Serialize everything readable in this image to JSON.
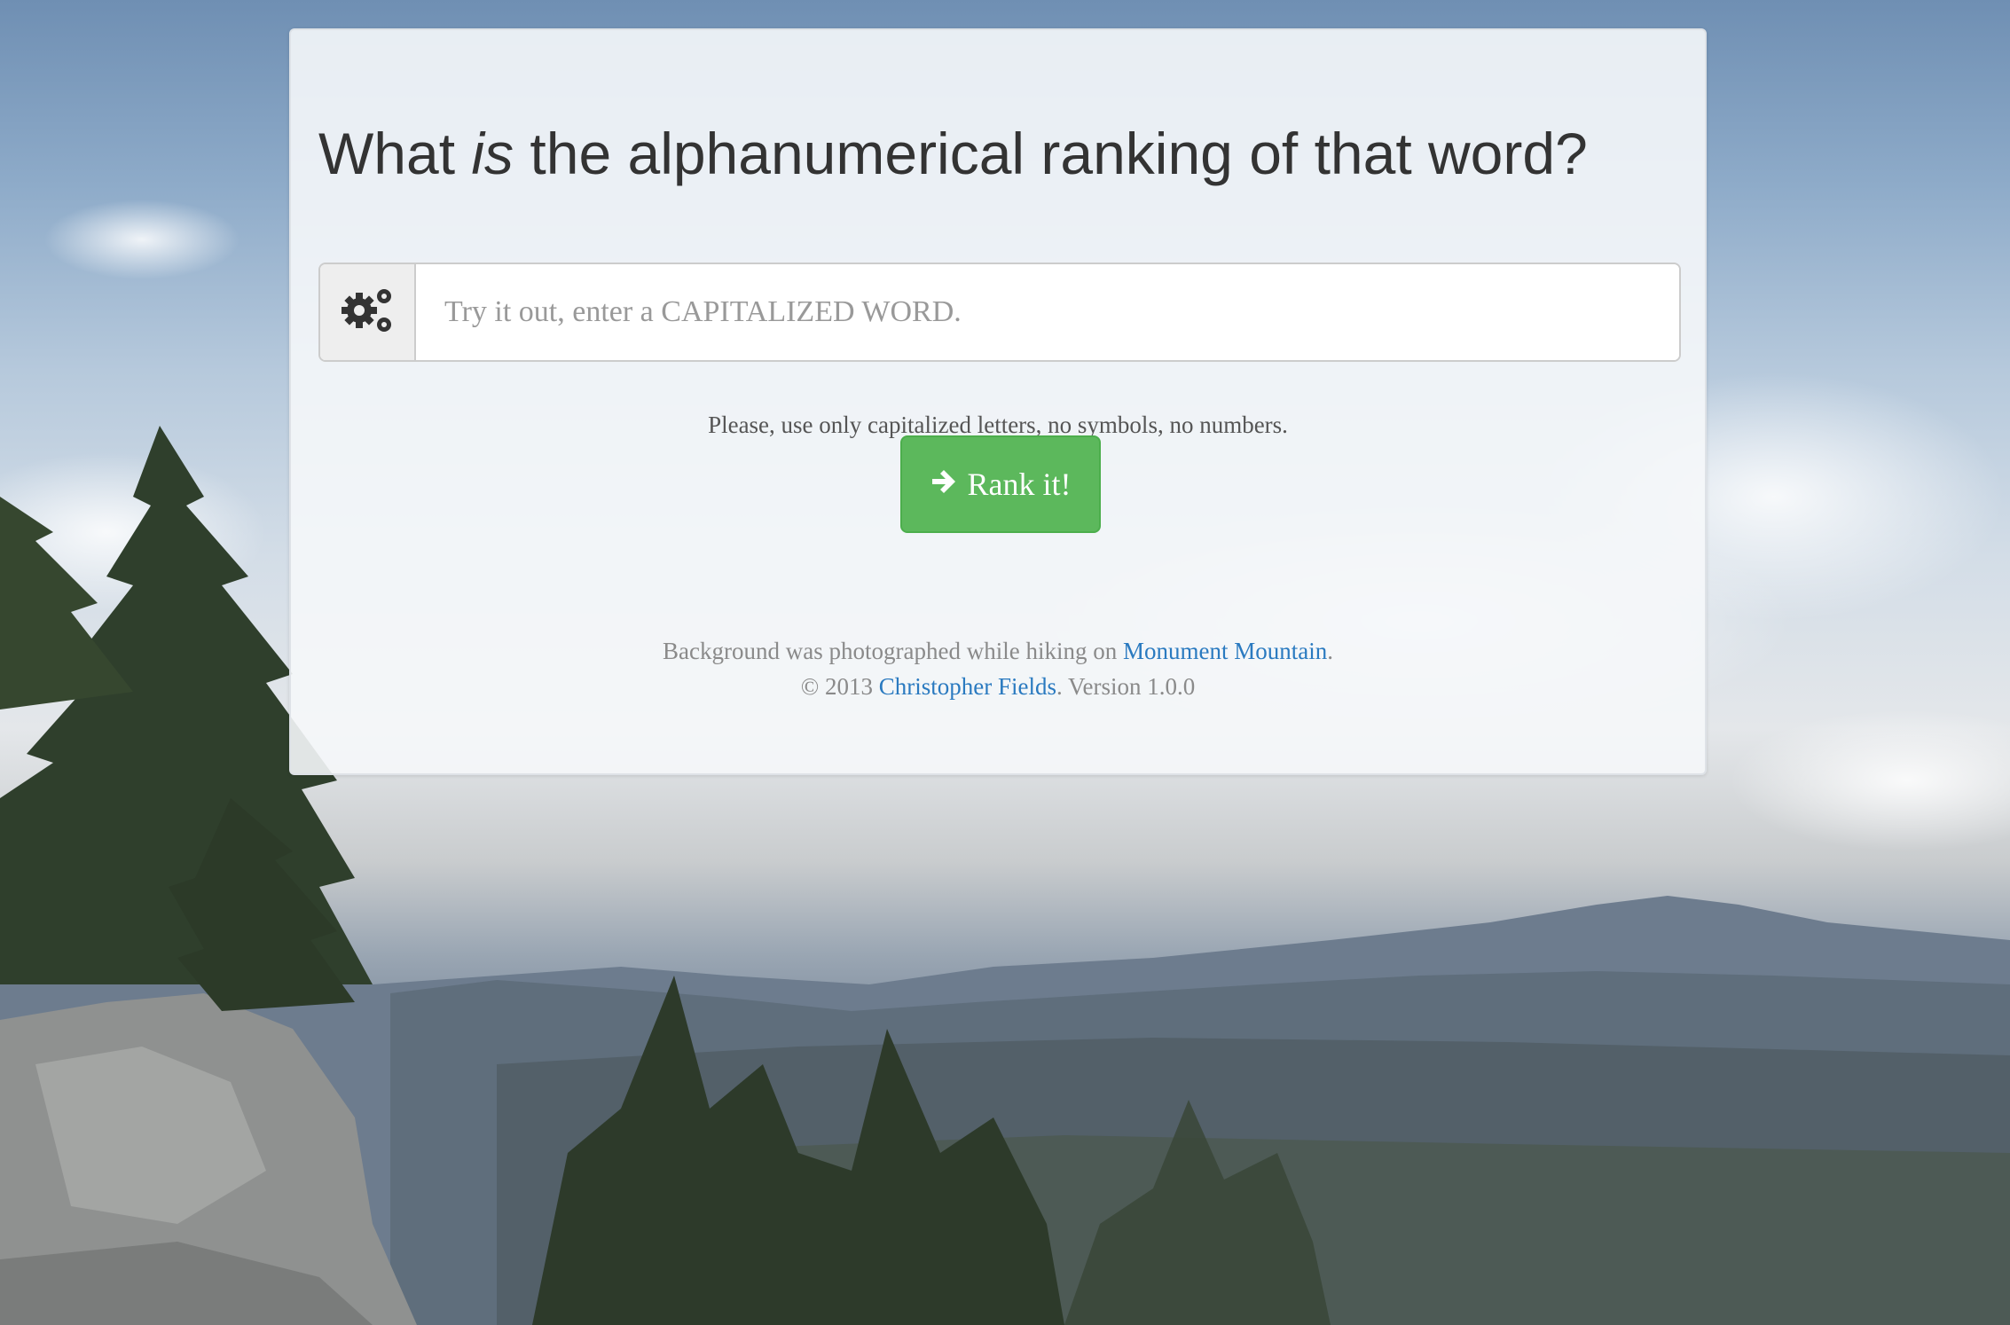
{
  "background": {
    "description_icon": "mountain-landscape-photo"
  },
  "panel": {
    "title_before": "What ",
    "title_em": "is",
    "title_after": " the alphanumerical ranking of that word?"
  },
  "form": {
    "addon_icon": "gears-icon",
    "input_placeholder": "Try it out, enter a CAPITALIZED WORD.",
    "input_value": "",
    "help_text": "Please, use only capitalized letters, no symbols, no numbers.",
    "submit_icon": "arrow-right-icon",
    "submit_label": "Rank it!"
  },
  "footer": {
    "line1_prefix": "Background was photographed while hiking on ",
    "line1_link": "Monument Mountain",
    "line1_suffix": ".",
    "line2_prefix": "© 2013 ",
    "line2_link": "Christopher Fields",
    "line2_suffix": ". Version 1.0.0"
  },
  "colors": {
    "button_green": "#5cb85c",
    "link_blue": "#2a7ac0",
    "title_text": "#333333"
  }
}
